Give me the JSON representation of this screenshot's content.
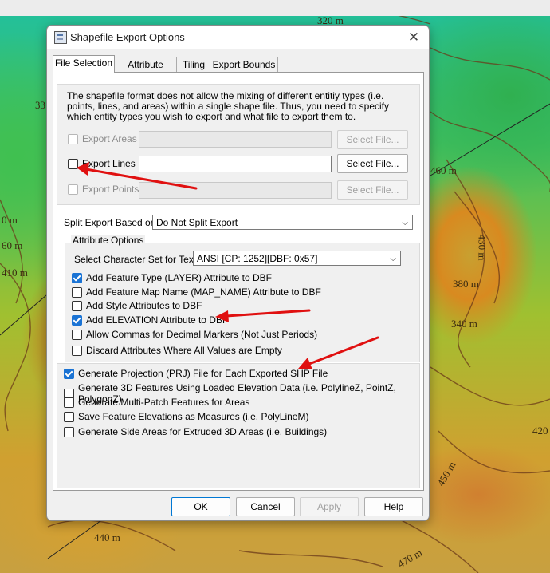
{
  "map": {
    "contours": [
      "320 m",
      "33",
      "460 m",
      "0 m",
      "60 m",
      "410 m",
      "430 m",
      "380 m",
      "340 m",
      "420",
      "450 m",
      "440 m",
      "470 m"
    ]
  },
  "dialog": {
    "title": "Shapefile Export Options",
    "tabs": [
      "File Selection",
      "Attribute Setup",
      "Tiling",
      "Export Bounds"
    ],
    "active_tab": "File Selection",
    "description": "The shapefile format does not allow the mixing of different entitiy types (i.e. points, lines, and areas) within a single shape file. Thus, you need to specify which entity types you wish to export and what file to export them to.",
    "export_rows": [
      {
        "label": "Export Areas",
        "checked": false,
        "enabled": false,
        "button": "Select File..."
      },
      {
        "label": "Export Lines",
        "checked": false,
        "enabled": true,
        "button": "Select File..."
      },
      {
        "label": "Export Points",
        "checked": false,
        "enabled": false,
        "button": "Select File..."
      }
    ],
    "split_label": "Split Export Based on:",
    "split_value": "Do Not Split Export",
    "attr_group_label": "Attribute Options",
    "charset_label": "Select Character Set for Text:",
    "charset_value": "ANSI [CP: 1252][DBF: 0x57]",
    "attr_options": [
      {
        "label": "Add Feature Type (LAYER) Attribute to DBF",
        "checked": true
      },
      {
        "label": "Add Feature Map Name (MAP_NAME) Attribute to DBF",
        "checked": false
      },
      {
        "label": "Add Style Attributes to DBF",
        "checked": false
      },
      {
        "label": "Add ELEVATION Attribute to DBF",
        "checked": true
      },
      {
        "label": "Allow Commas for Decimal Markers (Not Just Periods)",
        "checked": false
      },
      {
        "label": "Discard Attributes Where All Values are Empty",
        "checked": false
      }
    ],
    "general_options": [
      {
        "label": "Generate Projection (PRJ) File for Each Exported SHP File",
        "checked": true
      },
      {
        "label": "Generate 3D Features Using Loaded Elevation Data (i.e. PolylineZ, PointZ, PolygonZ)",
        "checked": false
      },
      {
        "label": "Generate Multi-Patch Features for Areas",
        "checked": false
      },
      {
        "label": "Save Feature Elevations as Measures (i.e. PolyLineM)",
        "checked": false
      },
      {
        "label": "Generate Side Areas for Extruded 3D Areas (i.e. Buildings)",
        "checked": false
      }
    ],
    "buttons": {
      "ok": "OK",
      "cancel": "Cancel",
      "apply": "Apply",
      "help": "Help"
    }
  },
  "colors": {
    "accent": "#1a73d4",
    "annotation_arrow": "#e01010"
  }
}
